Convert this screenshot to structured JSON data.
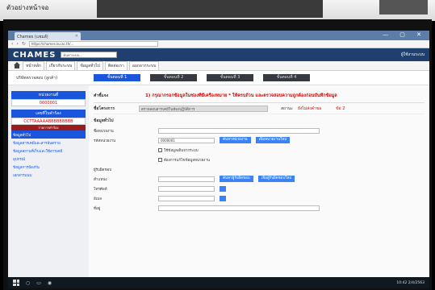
{
  "caption": "ตัวอย่างหน้าจอ",
  "browser": {
    "tab_title": "Chames (แชมส์)",
    "address": "https://chames.ku.ac.th/...",
    "window_controls": "— ▢ ✕"
  },
  "app": {
    "logo": "CHAMES",
    "search_placeholder": "ค้นหาระบบ...",
    "user": "ผู้ใช้งานระบบ"
  },
  "menu": [
    "หน้าหลัก",
    "เกี่ยวกับระบบ",
    "ข้อมูลทั่วไป",
    "ติดต่อเรา",
    "ออกจากระบบ"
  ],
  "steps": {
    "label": "บริษัทตรวจสอบ (ลูกค้า)",
    "items": [
      "ขั้นตอนที่ 1",
      "ขั้นตอนที่ 2",
      "ขั้นตอนที่ 3",
      "ขั้นตอนที่ 4"
    ]
  },
  "sidebar": {
    "head1": "หน่วยงานที่",
    "val1": "0000001",
    "head2": "เลขที่ใบคำร้อง",
    "val2": "CCTTAAAAABBBBBBBBB",
    "red": "รายการคำร้อง",
    "links": [
      "ข้อมูลทั่วไป",
      "ข้อมูลสารเคมีและสารอันตราย",
      "ข้อมูลสถานที่เก็บและใช้สารเคมี",
      "อุปกรณ์",
      "ข้อมูลการป้องกัน",
      "เอกสารแนบ"
    ]
  },
  "main": {
    "notice_label": "คำชี้แจง",
    "notice_text": "1) กรุณากรอกข้อมูลในช่องที่มีเครื่องหมาย * ให้ครบถ้วน และตรวจสอบความถูกต้องก่อนบันทึกข้อมูล",
    "project_label": "ชื่อโครงการ",
    "project_value": "ตรวจสอบสารเคมีในห้องปฏิบัติการ",
    "status_label": "สถานะ",
    "status_value": "ยังไม่ส่งคำขอ",
    "warn": "ข้อ 2",
    "section": "ข้อมูลทั่วไป",
    "fields": {
      "f1_label": "ชื่อหน่วยงาน",
      "f1_value": "",
      "f2_label": "รหัสหน่วยงาน",
      "f2_value": "0000001",
      "btn_search": "ค้นหาหน่วยงาน",
      "btn_add": "เพิ่มหน่วยงานใหม่",
      "chk1": "ใช้ข้อมูลเดิมจากระบบ",
      "chk2": "ต้องการแก้ไขข้อมูลหน่วยงาน",
      "f3_label": "ผู้รับผิดชอบ",
      "f4_label": "ตำแหน่ง",
      "f5_label": "โทรศัพท์",
      "f6_label": "อีเมล",
      "f7_label": "ที่อยู่",
      "btn_search2": "ค้นหาผู้รับผิดชอบ",
      "btn_add2": "เพิ่มผู้รับผิดชอบใหม่"
    }
  },
  "taskbar": {
    "clock": "10:42 2/4/2563"
  }
}
